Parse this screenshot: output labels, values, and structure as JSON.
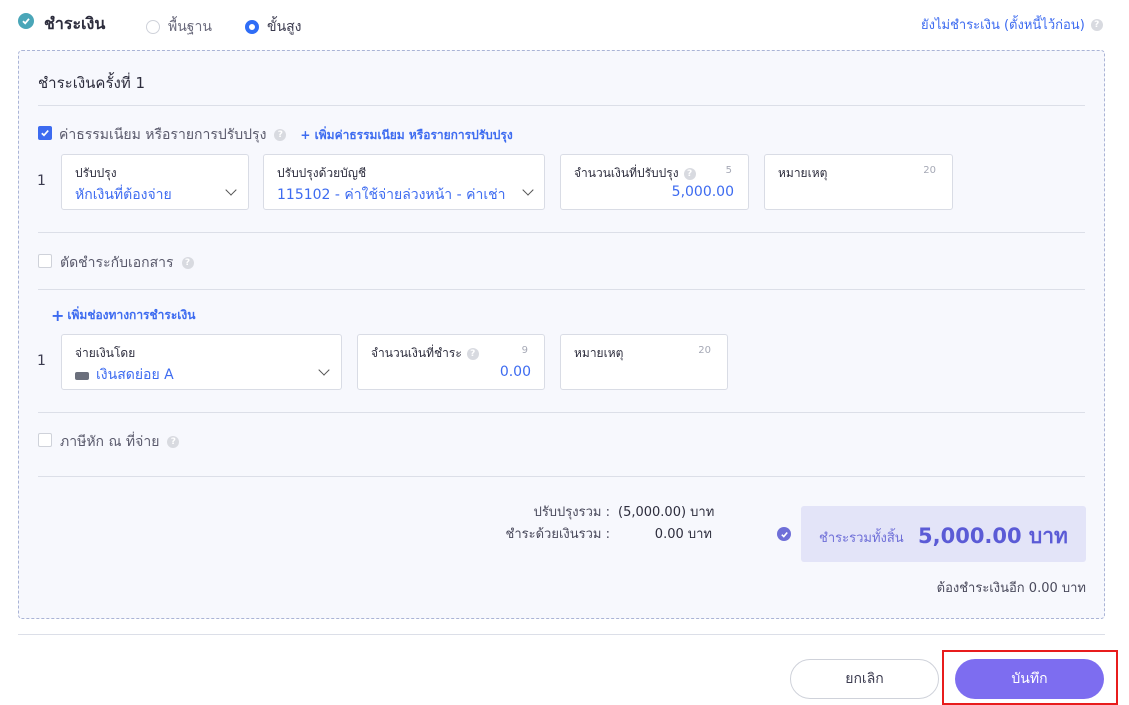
{
  "header": {
    "title": "ชำระเงิน",
    "mode_basic": "พื้นฐาน",
    "mode_advanced": "ขั้นสูง",
    "unpaid_link": "ยังไม่ชำระเงิน (ตั้งหนี้ไว้ก่อน)"
  },
  "payment": {
    "title": "ชำระเงินครั้งที่ 1",
    "fees": {
      "label": "ค่าธรรมเนียม หรือรายการปรับปรุง",
      "add_link": "+ เพิ่มค่าธรรมเนียม หรือรายการปรับปรุง",
      "row_number": "1",
      "adjust": {
        "label": "ปรับปรุง",
        "value": "หักเงินที่ต้องจ่าย"
      },
      "account": {
        "label": "ปรับปรุงด้วยบัญชี",
        "value": "115102 - ค่าใช้จ่ายล่วงหน้า - ค่าเช่า"
      },
      "amount": {
        "label": "จำนวนเงินที่ปรับปรุง",
        "count": "5",
        "value": "5,000.00"
      },
      "note": {
        "label": "หมายเหตุ",
        "count": "20"
      }
    },
    "offset_docs": {
      "label": "ตัดชำระกับเอกสาร"
    },
    "channel": {
      "add_link": "เพิ่มช่องทางการชำระเงิน",
      "row_number": "1",
      "pay_by": {
        "label": "จ่ายเงินโดย",
        "value": "เงินสดย่อย A"
      },
      "amount": {
        "label": "จำนวนเงินที่ชำระ",
        "count": "9",
        "value": "0.00"
      },
      "note": {
        "label": "หมายเหตุ",
        "count": "20"
      }
    },
    "withholding": {
      "label": "ภาษีหัก ณ ที่จ่าย"
    },
    "summary": {
      "adjust_label": "ปรับปรุงรวม :",
      "adjust_value": "(5,000.00) บาท",
      "paid_label": "ชำระด้วยเงินรวม :",
      "paid_value": "0.00 บาท",
      "total_label": "ชำระรวมทั้งสิ้น",
      "total_value": "5,000.00 บาท",
      "remaining": "ต้องชำระเงินอีก 0.00 บาท"
    }
  },
  "footer": {
    "cancel": "ยกเลิก",
    "save": "บันทึก"
  },
  "colors": {
    "accent": "#3d6bf0",
    "save_button": "#7d6df0",
    "highlight": "#e81c1c"
  }
}
